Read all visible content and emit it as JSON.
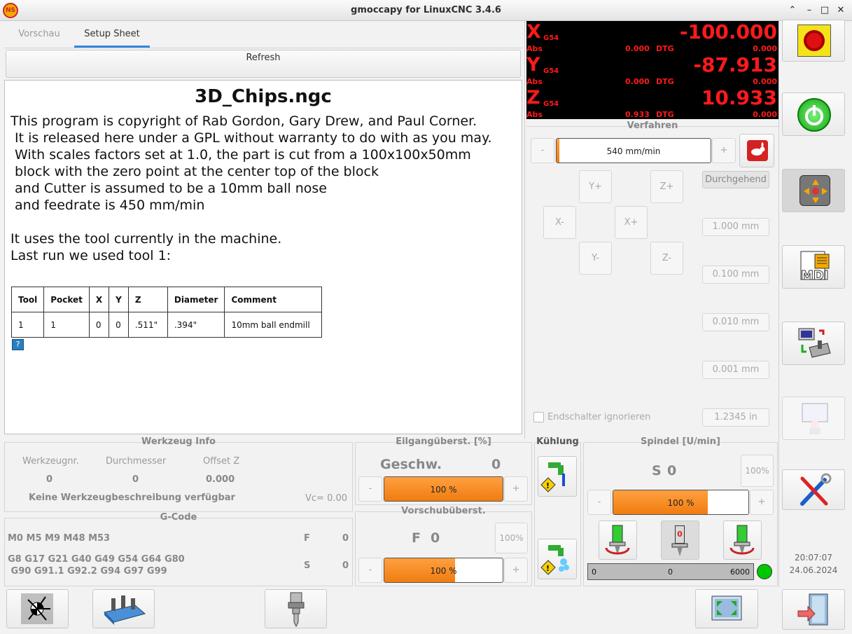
{
  "window": {
    "title": "gmoccapy for LinuxCNC  3.4.6",
    "app_icon": "NS",
    "btn_up": "⌃",
    "btn_min": "–",
    "btn_max": "□",
    "btn_close": "✕"
  },
  "tabs": [
    {
      "label": "Vorschau"
    },
    {
      "label": "Setup Sheet",
      "active": true
    }
  ],
  "refresh_label": "Refresh",
  "doc": {
    "title": "3D_Chips.ngc",
    "lines": [
      "This program is copyright of Rab Gordon, Gary Drew, and Paul Corner.",
      " It is released here under a GPL without warranty to do with as you may.",
      " With scales factors set at 1.0, the part is cut from a 100x100x50mm",
      " block with the zero point at the center top of the block",
      " and Cutter is assumed to be a 10mm ball nose",
      " and feedrate is 450 mm/min",
      "",
      "It uses the tool currently in the machine.",
      "Last run we used tool 1:"
    ],
    "table": {
      "headers": [
        "Tool",
        "Pocket",
        "X",
        "Y",
        "Z",
        "Diameter",
        "Comment"
      ],
      "row": [
        "1",
        "1",
        "0",
        "0",
        ".511\"",
        ".394\"",
        "10mm  ball endmill"
      ]
    },
    "help_icon": "?"
  },
  "dro": {
    "x": {
      "axis": "X",
      "cs": "G54",
      "value": "-100.000",
      "abs_label": "Abs",
      "abs": "0.000",
      "dtg_label": "DTG",
      "dtg": "0.000"
    },
    "y": {
      "axis": "Y",
      "cs": "G54",
      "value": "-87.913",
      "abs_label": "Abs",
      "abs": "0.000",
      "dtg_label": "DTG",
      "dtg": "0.000"
    },
    "z": {
      "axis": "Z",
      "cs": "G54",
      "value": "10.933",
      "abs_label": "Abs",
      "abs": "0.933",
      "dtg_label": "DTG",
      "dtg": "0.000"
    }
  },
  "jog": {
    "title": "Verfahren",
    "minus": "-",
    "plus": "+",
    "speed": "540 mm/min",
    "speed_fraction": 0.02,
    "yplus": "Y+",
    "zplus": "Z+",
    "xminus": "X-",
    "xplus": "X+",
    "yminus": "Y-",
    "zminus": "Z-",
    "continuous": "Durchgehend",
    "incs": [
      "1.000 mm",
      "0.100 mm",
      "0.010 mm",
      "0.001 mm"
    ],
    "inch": "1.2345 in",
    "ignore_limits": "Endschalter ignorieren"
  },
  "tool_info": {
    "title": "Werkzeug Info",
    "h1": "Werkzeugnr.",
    "h2": "Durchmesser",
    "h3": "Offset Z",
    "v1": "0",
    "v2": "0",
    "v3": "0.000",
    "desc": "Keine Werkzeugbeschreibung verfügbar",
    "vc": "Vc= 0.00"
  },
  "gcode": {
    "title": "G-Code",
    "mcodes": "M0 M5 M9 M48 M53",
    "gcodes1": "G8 G17 G21 G40 G49 G54 G64 G80",
    "gcodes2": " G90 G91.1 G92.2 G94 G97 G99",
    "f_label": "F",
    "f_val": "0",
    "s_label": "S",
    "s_val": "0"
  },
  "rapid": {
    "title": "Eilgangüberst. [%]",
    "label": "Geschw.",
    "value": "0",
    "minus": "-",
    "plus": "+",
    "pct": "100 %",
    "fill": 1.0
  },
  "feed": {
    "title": "Vorschubüberst.",
    "label": "F",
    "value": "0",
    "reset": "100%",
    "minus": "-",
    "plus": "+",
    "pct": "100 %",
    "fill": 0.6
  },
  "coolant": {
    "title": "Kühlung"
  },
  "spindle": {
    "title": "Spindel [U/min]",
    "label": "S",
    "value": "0",
    "reset": "100%",
    "minus": "-",
    "plus": "+",
    "pct": "100 %",
    "fill": 0.7,
    "stop": "0",
    "scale_min": "0",
    "scale_mid": "0",
    "scale_max": "6000"
  },
  "clock": {
    "time": "20:07:07",
    "date": "24.06.2024"
  },
  "colors": {
    "accent": "#f5841f",
    "dro_text": "#ff1a1a",
    "tab_active": "#3584e4",
    "status_led": "#00c800"
  }
}
